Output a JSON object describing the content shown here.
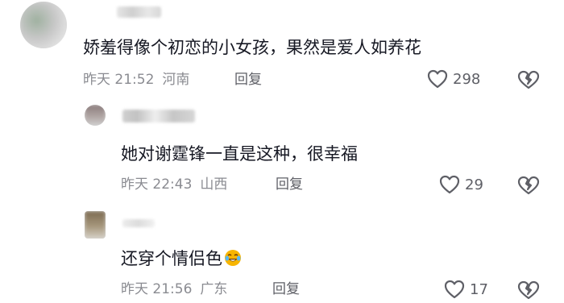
{
  "comments": [
    {
      "text": "娇羞得像个初恋的小女孩，果然是爱人如养花",
      "time": "昨天 21:52",
      "location": "河南",
      "reply_label": "回复",
      "likes": "298"
    },
    {
      "text": "她对谢霆锋一直是这种，很幸福",
      "time": "昨天 22:43",
      "location": "山西",
      "reply_label": "回复",
      "likes": "29"
    },
    {
      "text": "还穿个情侣色",
      "time": "昨天 21:56",
      "location": "广东",
      "reply_label": "回复",
      "likes": "17",
      "emoji": "crying-laughing-emoji"
    }
  ],
  "icons": {
    "like": "heart-outline-icon",
    "dislike": "broken-heart-icon"
  },
  "colors": {
    "text": "#161823",
    "meta": "#8a8b91",
    "icon": "#5e5f66",
    "emoji": "#f7b500"
  }
}
